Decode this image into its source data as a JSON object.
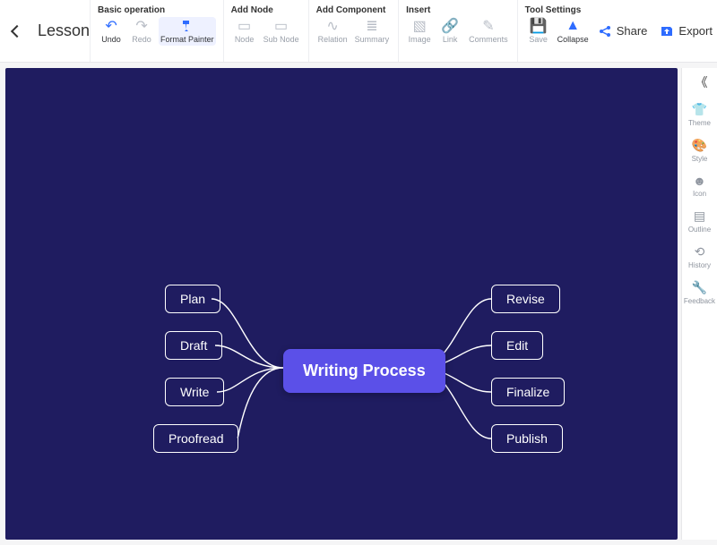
{
  "doc_title": "Lesson",
  "toolbar": {
    "groups": {
      "basic": {
        "label": "Basic operation",
        "undo": "Undo",
        "redo": "Redo",
        "format_painter": "Format Painter"
      },
      "add_node": {
        "label": "Add Node",
        "node": "Node",
        "sub_node": "Sub Node"
      },
      "add_component": {
        "label": "Add Component",
        "relation": "Relation",
        "summary": "Summary"
      },
      "insert": {
        "label": "Insert",
        "image": "Image",
        "link": "Link",
        "comments": "Comments"
      },
      "tool": {
        "label": "Tool Settings",
        "save": "Save",
        "collapse": "Collapse"
      }
    },
    "share": "Share",
    "export": "Export"
  },
  "sidebar": {
    "theme": "Theme",
    "style": "Style",
    "icon": "Icon",
    "outline": "Outline",
    "history": "History",
    "feedback": "Feedback"
  },
  "mindmap": {
    "center": "Writing Process",
    "left": [
      "Plan",
      "Draft",
      "Write",
      "Proofread"
    ],
    "right": [
      "Revise",
      "Edit",
      "Finalize",
      "Publish"
    ]
  }
}
